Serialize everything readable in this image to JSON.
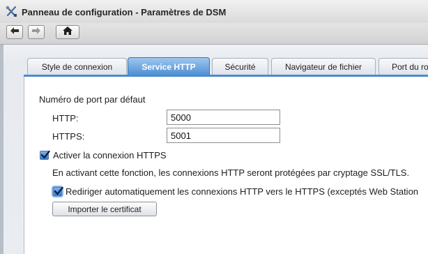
{
  "window": {
    "title": "Panneau de configuration - Paramètres de DSM"
  },
  "toolbar": {
    "back_icon": "arrow-left-icon",
    "forward_icon": "arrow-right-icon",
    "home_icon": "home-icon"
  },
  "tabs": [
    {
      "label": "Style de connexion",
      "active": false
    },
    {
      "label": "Service HTTP",
      "active": true
    },
    {
      "label": "Sécurité",
      "active": false
    },
    {
      "label": "Navigateur de fichier",
      "active": false
    },
    {
      "label": "Port du ro",
      "active": false
    }
  ],
  "http_service": {
    "section_title": "Numéro de port par défaut",
    "http_label": "HTTP:",
    "http_value": "5000",
    "https_label": "HTTPS:",
    "https_value": "5001",
    "enable_https_label": "Activer la connexion HTTPS",
    "enable_https_checked": true,
    "https_description": "En activant cette fonction, les connexions HTTP seront protégées par cryptage SSL/TLS.",
    "redirect_label": "Rediriger automatiquement les connexions HTTP vers le HTTPS (exceptés Web Station",
    "redirect_checked": true,
    "import_certificate_label": "Importer le certificat"
  },
  "colors": {
    "active_tab": "#4d8fd4",
    "checkbox": "#3c7fd0"
  }
}
